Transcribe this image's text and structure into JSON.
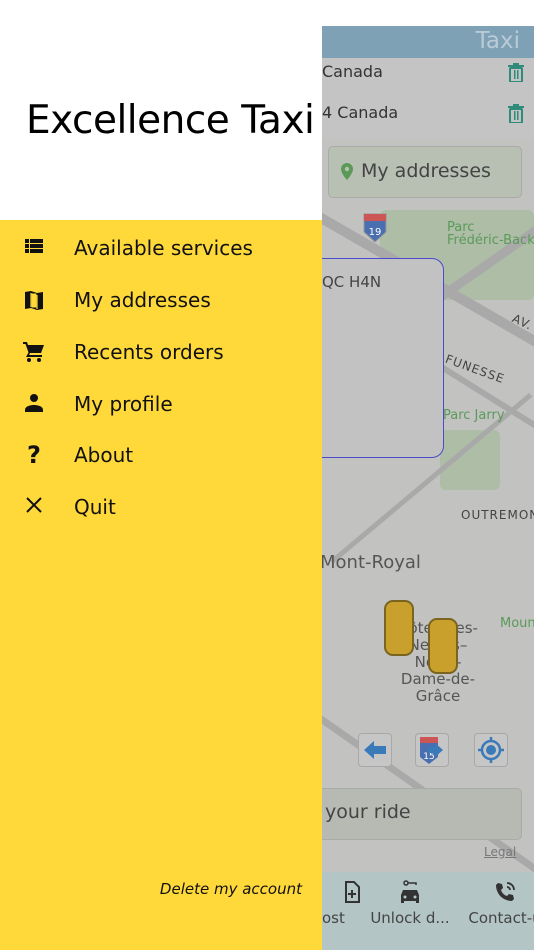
{
  "drawer": {
    "title": "Excellence Taxi",
    "items": [
      {
        "label": "Available services",
        "icon": "list-icon"
      },
      {
        "label": "My addresses",
        "icon": "map-icon"
      },
      {
        "label": "Recents orders",
        "icon": "cart-icon"
      },
      {
        "label": "My profile",
        "icon": "person-icon"
      },
      {
        "label": "About",
        "icon": "question-icon"
      },
      {
        "label": "Quit",
        "icon": "close-icon"
      }
    ],
    "delete_account": "Delete my account",
    "color": "#FFD93A"
  },
  "background": {
    "header_title": "Taxi",
    "addresses": [
      "Canada",
      "4 Canada"
    ],
    "my_addresses_button": "My addresses",
    "popup_text": "QC H4N",
    "ride_button": "your ride",
    "legal": "Legal",
    "map_labels": {
      "park1": "Parc\nFrédéric-Back",
      "av": "AV.",
      "street": "FUNESSE",
      "park2": "Parc Jarry",
      "outremont": "OUTREMONT",
      "mont_royal": "Mont-Royal",
      "cdn": "Côtes-des-\nNeiges–\nNotre-\nDame-de-\nGrâce",
      "moun": "Moun",
      "shield1": "19",
      "shield2": "15"
    },
    "tabs": [
      {
        "label": "ost",
        "icon": "document-add-icon"
      },
      {
        "label": "Unlock d...",
        "icon": "car-key-icon"
      },
      {
        "label": "Contact-u",
        "icon": "phone-call-icon"
      }
    ]
  }
}
